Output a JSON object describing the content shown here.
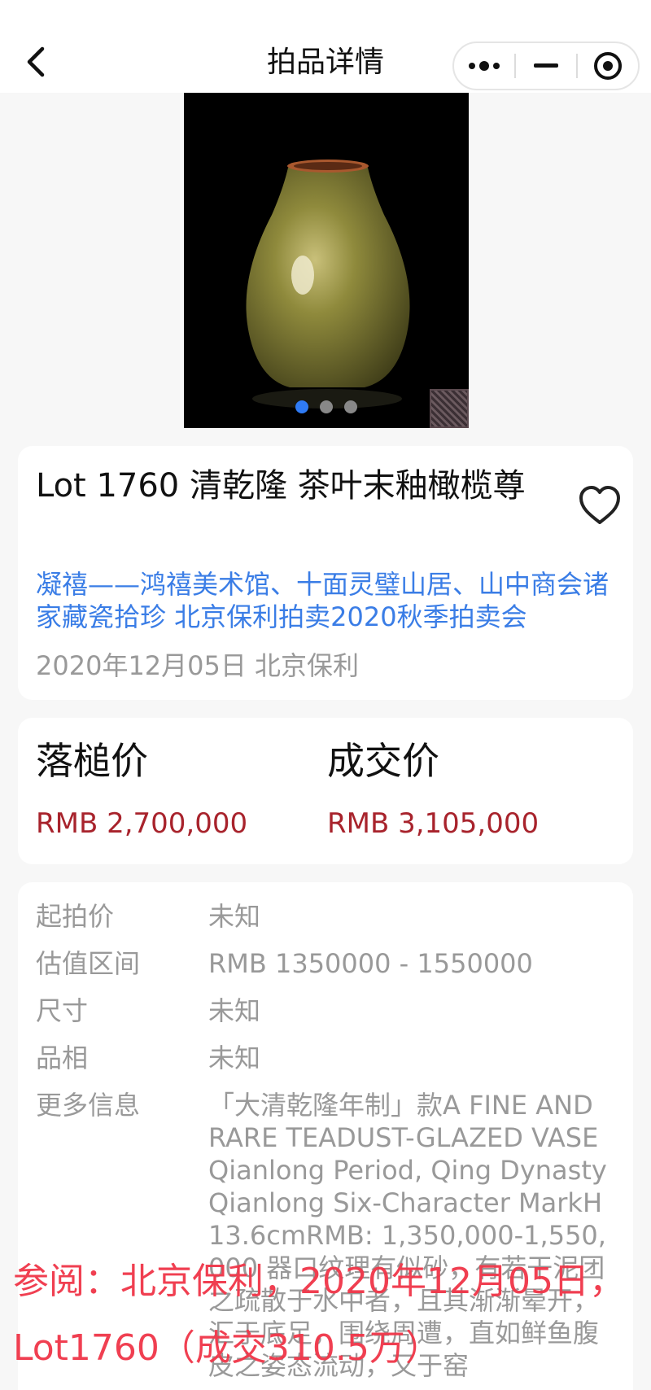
{
  "header": {
    "title": "拍品详情",
    "back_icon": "chevron-left-icon",
    "capsule": [
      "more-icon",
      "minimize-icon",
      "target-icon"
    ]
  },
  "gallery": {
    "image": "teadust-glazed-olive-vase",
    "dots": 3,
    "active_index": 0
  },
  "lot": {
    "title": "Lot 1760 清乾隆 茶叶末釉橄榄尊",
    "sale_name": "凝禧——鸿禧美术馆、十面灵璧山居、山中商会诸家藏瓷拾珍 北京保利拍卖2020秋季拍卖会",
    "date_house": "2020年12月05日 北京保利",
    "favorite_icon": "heart-outline-icon"
  },
  "prices": {
    "hammer_label": "落槌价",
    "hammer_value": "RMB 2,700,000",
    "sold_label": "成交价",
    "sold_value": "RMB 3,105,000"
  },
  "details": [
    {
      "label": "起拍价",
      "value": "未知"
    },
    {
      "label": "估值区间",
      "value": "RMB 1350000 - 1550000"
    },
    {
      "label": "尺寸",
      "value": "未知"
    },
    {
      "label": "品相",
      "value": "未知"
    },
    {
      "label": "更多信息",
      "value": "「大清乾隆年制」款A FINE AND RARE TEADUST-GLAZED VASEQianlong Period, Qing DynastyQianlong Six-Character MarkH13.6cmRMB: 1,350,000-1,550,000 器口纹理有似砂，有若干泥团之疏散于水中者，且其渐渐晕开，汇于底足，围绕周遭，直如鲜鱼腹皮之姿态流动，又于窑"
    }
  ],
  "watermark": "参阅：北京保利，2020年12月05日，Lot1760（成交310.5万）",
  "colors": {
    "accent_link": "#3a7de6",
    "price": "#a8232c",
    "dot_active": "#2f7bf5",
    "watermark": "#f0384a"
  }
}
